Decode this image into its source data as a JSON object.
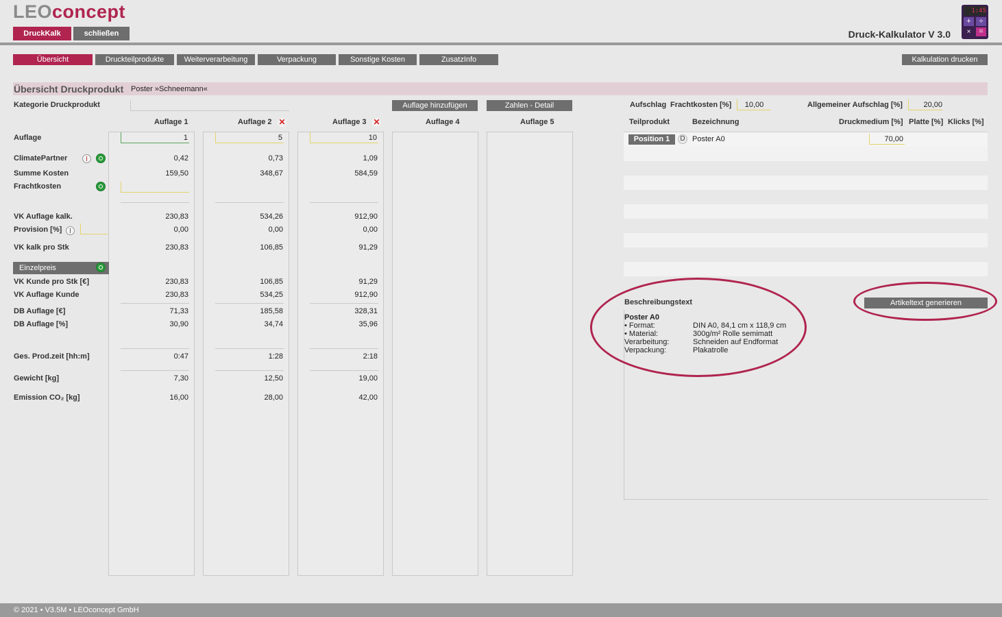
{
  "app": {
    "logo_grey": "LEO",
    "logo_red": "concept",
    "title": "Druck-Kalkulator V 3.0",
    "btn_druckkalk": "DruckKalk",
    "btn_close": "schließen",
    "calc_display": "1:45"
  },
  "tabs": [
    "Übersicht",
    "Druckteilprodukte",
    "Weiterverarbeitung",
    "Verpackung",
    "Sonstige Kosten",
    "ZusatzInfo"
  ],
  "print_button": "Kalkulation drucken",
  "section": {
    "title": "Übersicht Druckprodukt",
    "product": "Poster »Schneemann«"
  },
  "left": {
    "kategorie_label": "Kategorie Druckprodukt",
    "btn_add": "Auflage hinzufügen",
    "btn_detail": "Zahlen - Detail",
    "columns": [
      "Auflage 1",
      "Auflage 2",
      "Auflage 3",
      "Auflage 4",
      "Auflage 5"
    ],
    "labels": {
      "auflage": "Auflage",
      "climate": "ClimatePartner",
      "summe": "Summe Kosten",
      "fracht": "Frachtkosten",
      "vk_auflage_kalk": "VK Auflage kalk.",
      "provision": "Provision [%]",
      "vk_kalk_stk": "VK kalk pro Stk",
      "einzelpreis": "Einzelpreis",
      "vk_kunde_stk": "VK Kunde pro Stk [€]",
      "vk_auflage_kunde": "VK Auflage Kunde",
      "db_auflage_eur": "DB Auflage [€]",
      "db_auflage_pct": "DB Auflage [%]",
      "prodzeit": "Ges. Prod.zeit [hh:m]",
      "gewicht": "Gewicht [kg]",
      "emission": "Emission CO₂ [kg]"
    },
    "values": {
      "auflage": [
        "1",
        "5",
        "10"
      ],
      "climate": [
        "0,42",
        "0,73",
        "1,09"
      ],
      "summe": [
        "159,50",
        "348,67",
        "584,59"
      ],
      "vk_auflage_kalk": [
        "230,83",
        "534,26",
        "912,90"
      ],
      "provision": [
        "0,00",
        "0,00",
        "0,00"
      ],
      "vk_kalk_stk": [
        "230,83",
        "106,85",
        "91,29"
      ],
      "vk_kunde_stk": [
        "230,83",
        "106,85",
        "91,29"
      ],
      "vk_auflage_kunde": [
        "230,83",
        "534,25",
        "912,90"
      ],
      "db_auflage_eur": [
        "71,33",
        "185,58",
        "328,31"
      ],
      "db_auflage_pct": [
        "30,90",
        "34,74",
        "35,96"
      ],
      "prodzeit": [
        "0:47",
        "1:28",
        "2:18"
      ],
      "gewicht": [
        "7,30",
        "12,50",
        "19,00"
      ],
      "emission": [
        "16,00",
        "28,00",
        "42,00"
      ]
    }
  },
  "right": {
    "aufschlag_label": "Aufschlag",
    "fracht_label": "Frachtkosten [%]",
    "fracht_value": "10,00",
    "allg_label": "Allgemeiner Aufschlag [%]",
    "allg_value": "20,00",
    "headers": [
      "Teilprodukt",
      "Bezeichnung",
      "Druckmedium [%]",
      "Platte [%]",
      "Klicks [%]"
    ],
    "position_btn": "Position 1",
    "position_d": "D",
    "position_name": "Poster A0",
    "position_druckmedium": "70,00",
    "beschreibung_label": "Beschreibungstext",
    "artikel_btn": "Artikeltext generieren",
    "desc_title": "Poster A0",
    "desc_rows": [
      {
        "k": "• Format:",
        "v": "DIN A0, 84,1 cm x 118,9 cm"
      },
      {
        "k": "• Material:",
        "v": "300g/m² Rolle semimatt"
      },
      {
        "k": "Verarbeitung:",
        "v": "Schneiden auf Endformat"
      },
      {
        "k": "Verpackung:",
        "v": "Plakatrolle"
      }
    ]
  },
  "footer": "© 2021 • V3.5M • LEOconcept GmbH",
  "colors": {
    "accent": "#b0244f",
    "button_grey": "#6e6e6e",
    "highlight": "#e3d46a"
  }
}
